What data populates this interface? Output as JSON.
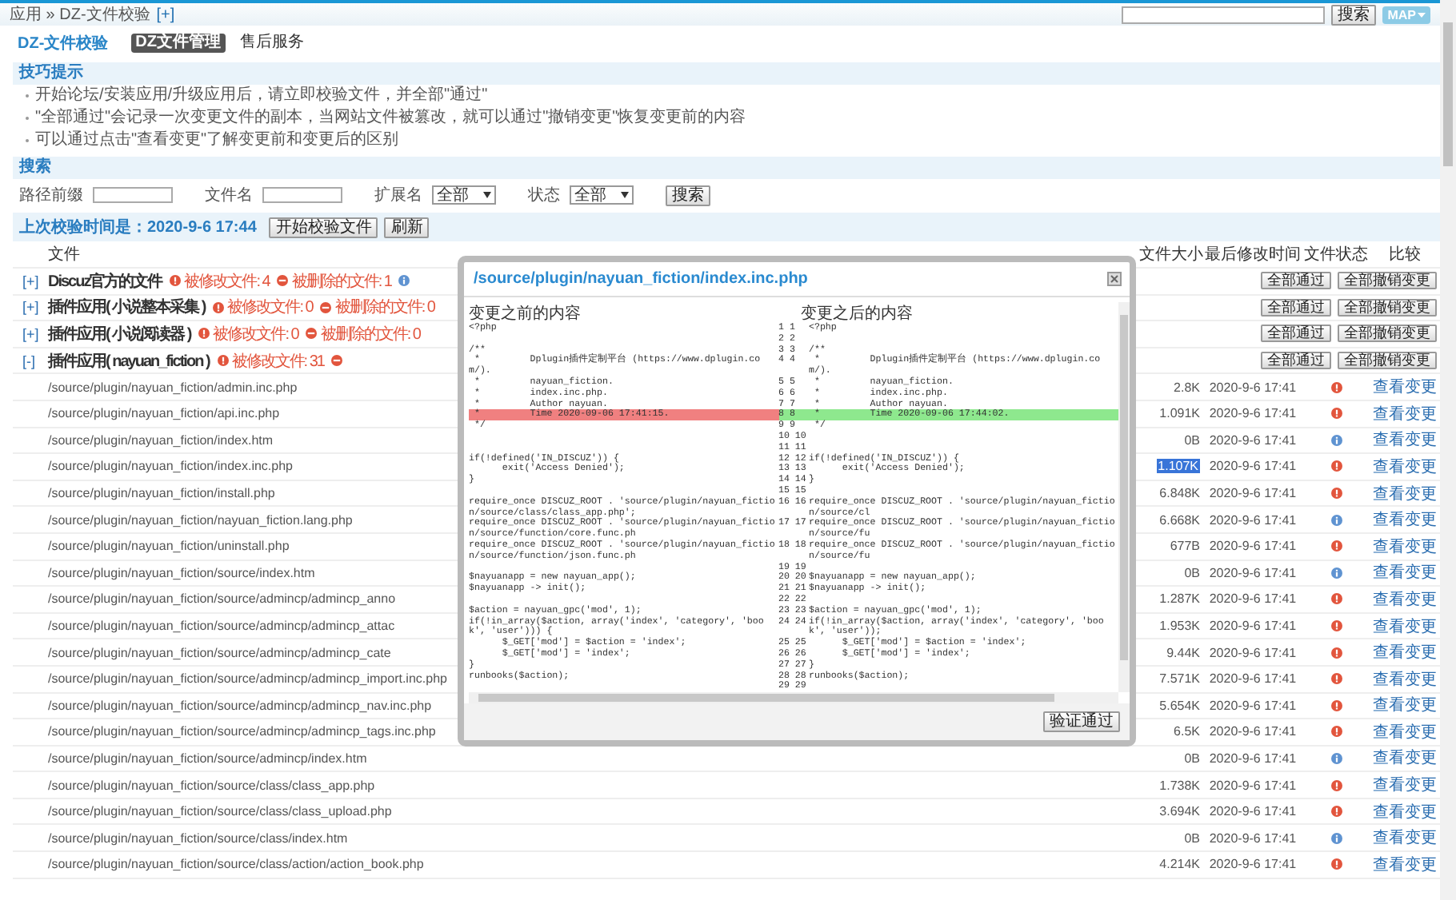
{
  "header": {
    "breadcrumb": "应用 » DZ-文件校验",
    "expand_link": "[+]",
    "search_button": "搜索",
    "map_button": "MAP"
  },
  "title": "DZ-文件校验",
  "tabs": [
    {
      "label": "DZ文件管理",
      "selected": true
    },
    {
      "label": "售后服务",
      "selected": false
    }
  ],
  "tips": {
    "title": "技巧提示",
    "items": [
      "开始论坛/安装应用/升级应用后，请立即校验文件，并全部\"通过\"",
      "\"全部通过\"会记录一次变更文件的副本，当网站文件被篡改，就可以通过\"撤销变更\"恢复变更前的内容",
      "可以通过点击\"查看变更\"了解变更前和变更后的区别"
    ]
  },
  "search": {
    "title": "搜索",
    "fields": [
      {
        "label": "路径前缀",
        "kind": "input"
      },
      {
        "label": "文件名",
        "kind": "input"
      },
      {
        "label": "扩展名",
        "kind": "select",
        "value": "全部"
      },
      {
        "label": "状态",
        "kind": "select",
        "value": "全部"
      }
    ],
    "button": "搜索"
  },
  "check": {
    "last_time": "上次校验时间是：2020-9-6 17:44",
    "buttons": [
      "开始校验文件",
      "刷新"
    ]
  },
  "table": {
    "columns": [
      "文件",
      "文件大小",
      "最后修改时间",
      "文件状态",
      "比较"
    ],
    "rows": [
      {
        "kind": "group",
        "toggle": "[+]",
        "name": "Discuz官方的文件",
        "badges": [
          {
            "kind": "modified",
            "text": "被修改文件: 4"
          },
          {
            "kind": "deleted",
            "text": "被删除的文件: 1"
          },
          {
            "kind": "info"
          }
        ],
        "buttons": [
          "全部通过",
          "全部撤销变更"
        ]
      },
      {
        "kind": "group",
        "toggle": "[+]",
        "name": "插件应用( 小说整本采集 )",
        "badges": [
          {
            "kind": "modified",
            "text": "被修改文件: 0"
          },
          {
            "kind": "deleted",
            "text": "被删除的文件: 0"
          }
        ],
        "buttons": [
          "全部通过",
          "全部撤销变更"
        ]
      },
      {
        "kind": "group",
        "toggle": "[+]",
        "name": "插件应用( 小说阅读器 )",
        "badges": [
          {
            "kind": "modified",
            "text": "被修改文件: 0"
          },
          {
            "kind": "deleted",
            "text": "被删除的文件: 0"
          }
        ],
        "buttons": [
          "全部通过",
          "全部撤销变更"
        ]
      },
      {
        "kind": "group",
        "toggle": "[-]",
        "name": "插件应用( nayuan_fiction )",
        "badges": [
          {
            "kind": "modified",
            "text": "被修改文件: 31"
          },
          {
            "kind": "deleted"
          }
        ],
        "buttons": [
          "全部通过",
          "全部撤销变更"
        ]
      },
      {
        "kind": "file",
        "path": "/source/plugin/nayuan_fiction/admin.inc.php",
        "size": "2.8K",
        "size_selected": false,
        "time": "2020-9-6 17:41",
        "status": {
          "kind": "modified"
        },
        "link": "查看变更"
      },
      {
        "kind": "file",
        "path": "/source/plugin/nayuan_fiction/api.inc.php",
        "size": "1.091K",
        "size_selected": false,
        "time": "2020-9-6 17:41",
        "status": {
          "kind": "modified"
        },
        "link": "查看变更"
      },
      {
        "kind": "file",
        "path": "/source/plugin/nayuan_fiction/index.htm",
        "size": "0B",
        "size_selected": false,
        "time": "2020-9-6 17:41",
        "status": {
          "kind": "info"
        },
        "link": "查看变更"
      },
      {
        "kind": "file",
        "path": "/source/plugin/nayuan_fiction/index.inc.php",
        "size": "1.107K",
        "size_selected": true,
        "time": "2020-9-6 17:41",
        "status": {
          "kind": "modified"
        },
        "link": "查看变更"
      },
      {
        "kind": "file",
        "path": "/source/plugin/nayuan_fiction/install.php",
        "size": "6.848K",
        "size_selected": false,
        "time": "2020-9-6 17:41",
        "status": {
          "kind": "modified"
        },
        "link": "查看变更"
      },
      {
        "kind": "file",
        "path": "/source/plugin/nayuan_fiction/nayuan_fiction.lang.php",
        "size": "6.668K",
        "size_selected": false,
        "time": "2020-9-6 17:41",
        "status": {
          "kind": "info"
        },
        "link": "查看变更"
      },
      {
        "kind": "file",
        "path": "/source/plugin/nayuan_fiction/uninstall.php",
        "size": "677B",
        "size_selected": false,
        "time": "2020-9-6 17:41",
        "status": {
          "kind": "modified"
        },
        "link": "查看变更"
      },
      {
        "kind": "file",
        "path": "/source/plugin/nayuan_fiction/source/index.htm",
        "size": "0B",
        "size_selected": false,
        "time": "2020-9-6 17:41",
        "status": {
          "kind": "info"
        },
        "link": "查看变更"
      },
      {
        "kind": "file",
        "path": "/source/plugin/nayuan_fiction/source/admincp/admincp_anno",
        "size": "1.287K",
        "size_selected": false,
        "time": "2020-9-6 17:41",
        "status": {
          "kind": "modified"
        },
        "link": "查看变更"
      },
      {
        "kind": "file",
        "path": "/source/plugin/nayuan_fiction/source/admincp/admincp_attac",
        "size": "1.953K",
        "size_selected": false,
        "time": "2020-9-6 17:41",
        "status": {
          "kind": "modified"
        },
        "link": "查看变更"
      },
      {
        "kind": "file",
        "path": "/source/plugin/nayuan_fiction/source/admincp/admincp_cate",
        "size": "9.44K",
        "size_selected": false,
        "time": "2020-9-6 17:41",
        "status": {
          "kind": "modified"
        },
        "link": "查看变更"
      },
      {
        "kind": "file",
        "path": "/source/plugin/nayuan_fiction/source/admincp/admincp_import.inc.php",
        "size": "7.571K",
        "size_selected": false,
        "time": "2020-9-6 17:41",
        "status": {
          "kind": "modified"
        },
        "link": "查看变更"
      },
      {
        "kind": "file",
        "path": "/source/plugin/nayuan_fiction/source/admincp/admincp_nav.inc.php",
        "size": "5.654K",
        "size_selected": false,
        "time": "2020-9-6 17:41",
        "status": {
          "kind": "modified"
        },
        "link": "查看变更"
      },
      {
        "kind": "file",
        "path": "/source/plugin/nayuan_fiction/source/admincp/admincp_tags.inc.php",
        "size": "6.5K",
        "size_selected": false,
        "time": "2020-9-6 17:41",
        "status": {
          "kind": "modified"
        },
        "link": "查看变更"
      },
      {
        "kind": "file",
        "path": "/source/plugin/nayuan_fiction/source/admincp/index.htm",
        "size": "0B",
        "size_selected": false,
        "time": "2020-9-6 17:41",
        "status": {
          "kind": "info"
        },
        "link": "查看变更"
      },
      {
        "kind": "file",
        "path": "/source/plugin/nayuan_fiction/source/class/class_app.php",
        "size": "1.738K",
        "size_selected": false,
        "time": "2020-9-6 17:41",
        "status": {
          "kind": "modified"
        },
        "link": "查看变更"
      },
      {
        "kind": "file",
        "path": "/source/plugin/nayuan_fiction/source/class/class_upload.php",
        "size": "3.694K",
        "size_selected": false,
        "time": "2020-9-6 17:41",
        "status": {
          "kind": "modified"
        },
        "link": "查看变更"
      },
      {
        "kind": "file",
        "path": "/source/plugin/nayuan_fiction/source/class/index.htm",
        "size": "0B",
        "size_selected": false,
        "time": "2020-9-6 17:41",
        "status": {
          "kind": "info"
        },
        "link": "查看变更"
      },
      {
        "kind": "file",
        "path": "/source/plugin/nayuan_fiction/source/class/action/action_book.php",
        "size": "4.214K",
        "size_selected": false,
        "time": "2020-9-6 17:41",
        "status": {
          "kind": "modified"
        },
        "link": "查看变更"
      }
    ]
  },
  "dialog": {
    "title": "/source/plugin/nayuan_fiction/index.inc.php",
    "before": {
      "title": "变更之前的内容",
      "lines": [
        {
          "text": "<?php",
          "changed": false
        },
        {
          "changed": false
        },
        {
          "text": "/**",
          "changed": false
        },
        {
          "text": " *         Dplugin插件定制平台 (https://www.dplugin.com/).",
          "changed": false
        },
        {
          "text": " *         nayuan_fiction.",
          "changed": false
        },
        {
          "text": " *         index.inc.php.",
          "changed": false
        },
        {
          "text": " *         Author nayuan.",
          "changed": false
        },
        {
          "text": " *         Time 2020-09-06 17:41:15.",
          "changed": true
        },
        {
          "text": " */",
          "changed": false
        },
        {
          "changed": false
        },
        {
          "changed": false
        },
        {
          "text": "if(!defined('IN_DISCUZ')) {",
          "changed": false
        },
        {
          "text": "      exit('Access Denied');",
          "changed": false
        },
        {
          "text": "}",
          "changed": false
        },
        {
          "changed": false
        },
        {
          "text": "require_once DISCUZ_ROOT . 'source/plugin/nayuan_fiction/source/class/class_app.php';",
          "changed": false
        },
        {
          "text": "require_once DISCUZ_ROOT . 'source/plugin/nayuan_fiction/source/function/core.func.ph",
          "changed": false
        },
        {
          "text": "require_once DISCUZ_ROOT . 'source/plugin/nayuan_fiction/source/function/json.func.ph",
          "changed": false
        },
        {
          "changed": false
        },
        {
          "text": "$nayuanapp = new nayuan_app();",
          "changed": false
        },
        {
          "text": "$nayuanapp -> init();",
          "changed": false
        },
        {
          "changed": false
        },
        {
          "text": "$action = nayuan_gpc('mod', 1);",
          "changed": false
        },
        {
          "text": "if(!in_array($action, array('index', 'category', 'book', 'user'))) {",
          "changed": false
        },
        {
          "text": "      $_GET['mod'] = $action = 'index';",
          "changed": false
        },
        {
          "text": "      $_GET['mod'] = 'index';",
          "changed": false
        },
        {
          "text": "}",
          "changed": false
        },
        {
          "text": "runbooks($action);",
          "changed": false
        }
      ]
    },
    "after": {
      "title": "变更之后的内容",
      "lines": [
        {
          "num": "1 1",
          "text": "<?php",
          "changed": false
        },
        {
          "num": "2 2",
          "changed": false
        },
        {
          "num": "3 3",
          "text": "/**",
          "changed": false
        },
        {
          "num": "4 4",
          "text": " *         Dplugin插件定制平台 (https://www.dplugin.com/).",
          "changed": false
        },
        {
          "num": "5 5",
          "text": " *         nayuan_fiction.",
          "changed": false
        },
        {
          "num": "6 6",
          "text": " *         index.inc.php.",
          "changed": false
        },
        {
          "num": "7 7",
          "text": " *         Author nayuan.",
          "changed": false
        },
        {
          "num": "8 8",
          "text": " *         Time 2020-09-06 17:44:02.",
          "changed": true
        },
        {
          "num": "9 9",
          "text": " */",
          "changed": false
        },
        {
          "num": "10 10",
          "changed": false
        },
        {
          "num": "11 11",
          "changed": false
        },
        {
          "num": "12 12",
          "text": "if(!defined('IN_DISCUZ')) {",
          "changed": false
        },
        {
          "num": "13 13",
          "text": "      exit('Access Denied');",
          "changed": false
        },
        {
          "num": "14 14",
          "text": "}",
          "changed": false
        },
        {
          "num": "15 15",
          "changed": false
        },
        {
          "num": "16 16",
          "text": "require_once DISCUZ_ROOT . 'source/plugin/nayuan_fiction/source/cl",
          "changed": false
        },
        {
          "num": "17 17",
          "text": "require_once DISCUZ_ROOT . 'source/plugin/nayuan_fiction/source/fu",
          "changed": false
        },
        {
          "num": "18 18",
          "text": "require_once DISCUZ_ROOT . 'source/plugin/nayuan_fiction/source/fu",
          "changed": false
        },
        {
          "num": "19 19",
          "changed": false
        },
        {
          "num": "20 20",
          "text": "$nayuanapp = new nayuan_app();",
          "changed": false
        },
        {
          "num": "21 21",
          "text": "$nayuanapp -> init();",
          "changed": false
        },
        {
          "num": "22 22",
          "changed": false
        },
        {
          "num": "23 23",
          "text": "$action = nayuan_gpc('mod', 1);",
          "changed": false
        },
        {
          "num": "24 24",
          "text": "if(!in_array($action, array('index', 'category', 'book', 'user'));",
          "changed": false
        },
        {
          "num": "25 25",
          "text": "      $_GET['mod'] = $action = 'index';",
          "changed": false
        },
        {
          "num": "26 26",
          "text": "      $_GET['mod'] = 'index';",
          "changed": false
        },
        {
          "num": "27 27",
          "text": "}",
          "changed": false
        },
        {
          "num": "28 28",
          "text": "runbooks($action);",
          "changed": false
        },
        {
          "num": "29 29",
          "changed": false
        }
      ]
    },
    "button": "验证通过"
  }
}
